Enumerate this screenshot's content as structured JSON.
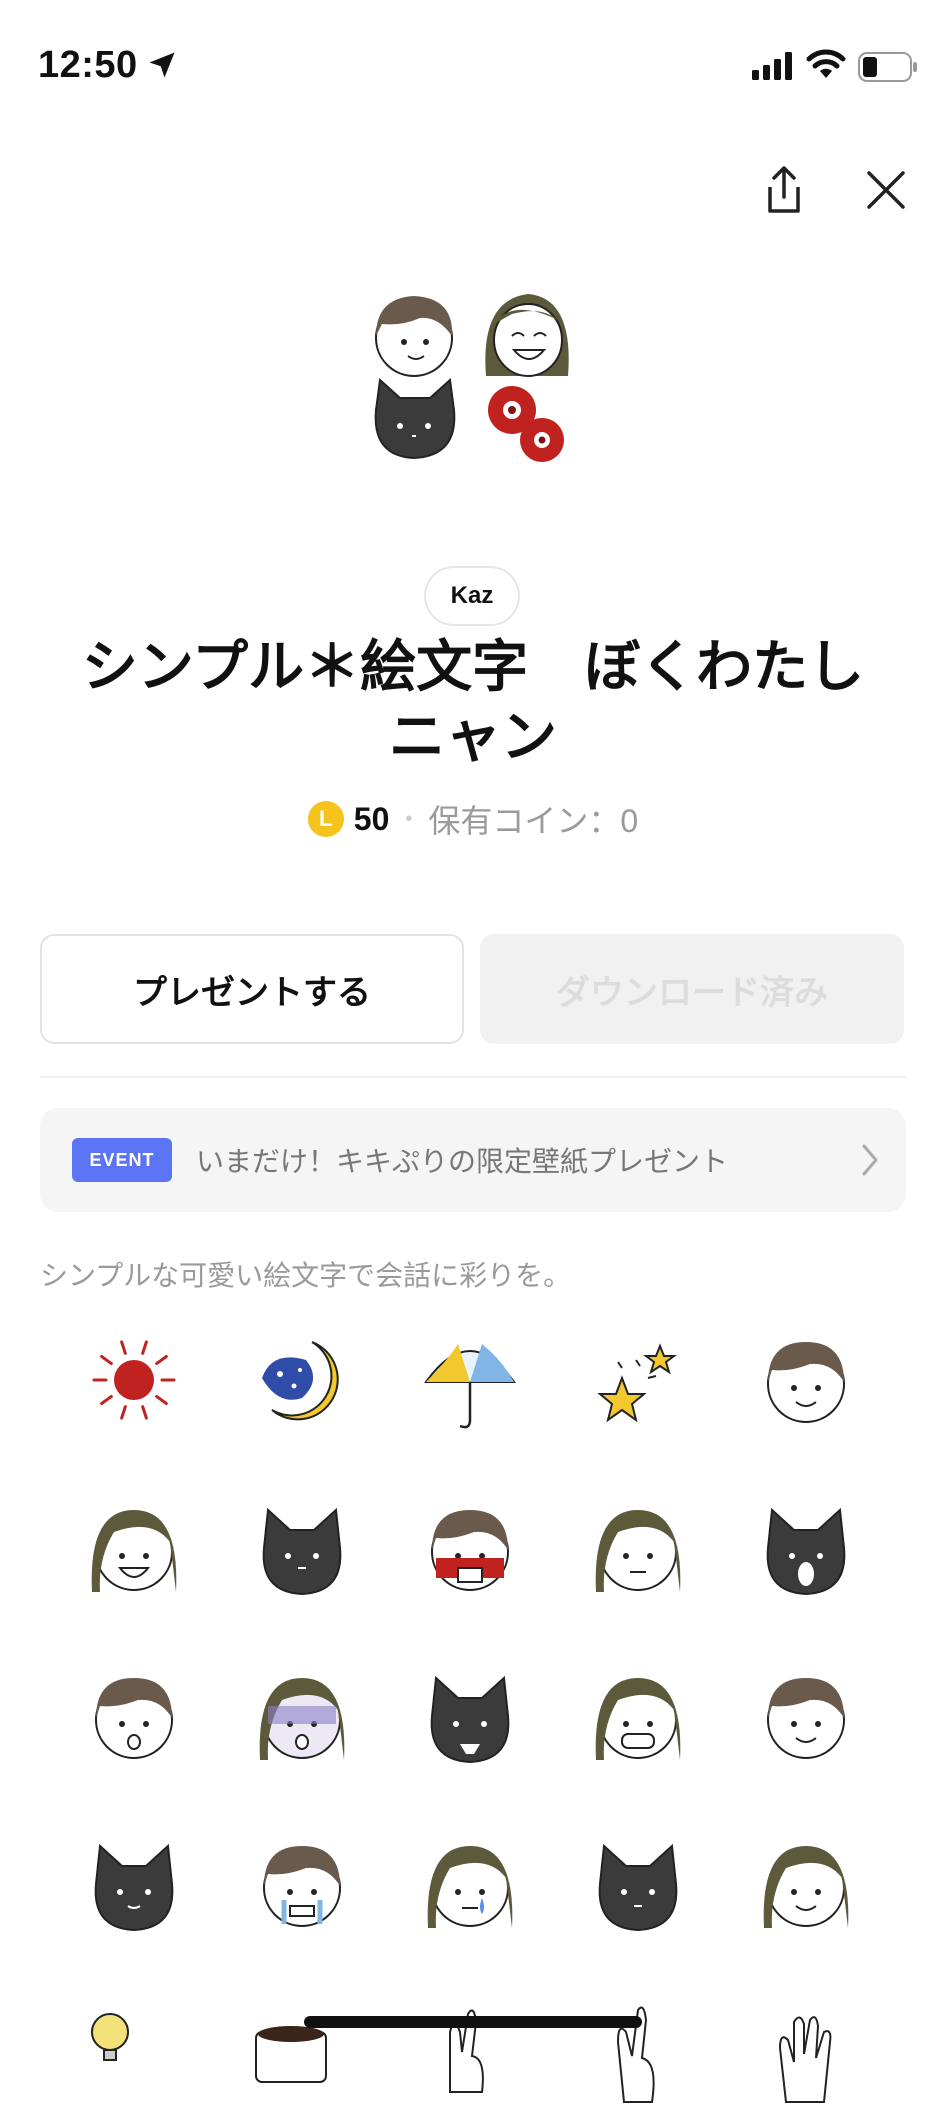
{
  "status_bar": {
    "time": "12:50"
  },
  "header": {
    "share_icon": "share-icon",
    "close_icon": "close-icon"
  },
  "product": {
    "creator": "Kaz",
    "title": "シンプル＊絵文字　ぼくわたしニャン",
    "coin_symbol": "L",
    "price": "50",
    "owned_coins": "保有コイン：0",
    "description": "シンプルな可愛い絵文字で会話に彩りを。"
  },
  "actions": {
    "gift_label": "プレゼントする",
    "download_label": "ダウンロード済み"
  },
  "event": {
    "badge": "EVENT",
    "text": "いまだけ！キキぷりの限定壁紙プレゼント"
  },
  "emoji_grid": [
    "sun",
    "moon",
    "umbrella",
    "stars",
    "boy-smile",
    "girl-laugh",
    "black-cat",
    "boy-angry",
    "girl-annoyed",
    "cat-yawn",
    "boy-surprised",
    "girl-shocked",
    "cat-scared",
    "girl-grin",
    "boy-wink",
    "cat-ok",
    "boy-crying",
    "girl-tear",
    "cat-sleepy",
    "girl-calm",
    "lightbulb",
    "coffee",
    "hand-peace",
    "hand-victory",
    "hand-wave"
  ],
  "colors": {
    "accent": "#5b74f3",
    "coin": "#f5c31c",
    "hair": "#6a5a4c",
    "girl_hair": "#5d5a3c",
    "cat": "#3b3b3b",
    "red": "#c0231f"
  }
}
